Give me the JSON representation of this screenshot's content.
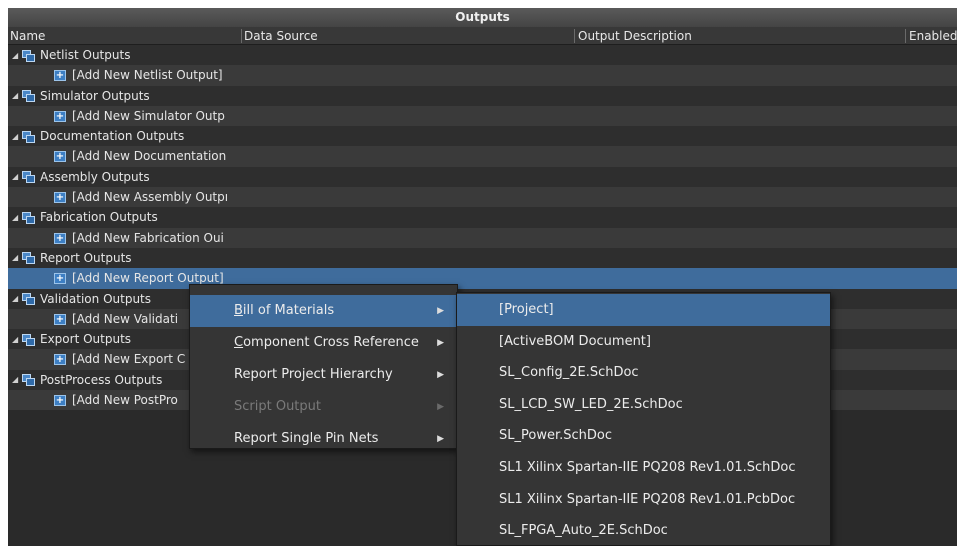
{
  "panel": {
    "title": "Outputs",
    "columns": [
      "Name",
      "Data Source",
      "Output Description",
      "Enabled"
    ]
  },
  "rows": [
    {
      "type": "group",
      "label": "Netlist Outputs"
    },
    {
      "type": "child",
      "label": "[Add New Netlist Output]"
    },
    {
      "type": "group",
      "label": "Simulator Outputs"
    },
    {
      "type": "child",
      "label": "[Add New Simulator Outp"
    },
    {
      "type": "group",
      "label": "Documentation Outputs"
    },
    {
      "type": "child",
      "label": "[Add New Documentation"
    },
    {
      "type": "group",
      "label": "Assembly Outputs"
    },
    {
      "type": "child",
      "label": "[Add New Assembly Outpı"
    },
    {
      "type": "group",
      "label": "Fabrication Outputs"
    },
    {
      "type": "child",
      "label": "[Add New Fabrication Oui"
    },
    {
      "type": "group",
      "label": "Report Outputs"
    },
    {
      "type": "child",
      "label": "[Add New Report Output]",
      "selected": true
    },
    {
      "type": "group",
      "label": "Validation Outputs"
    },
    {
      "type": "child",
      "label": "[Add New Validati"
    },
    {
      "type": "group",
      "label": "Export Outputs"
    },
    {
      "type": "child",
      "label": "[Add New Export C"
    },
    {
      "type": "group",
      "label": "PostProcess Outputs"
    },
    {
      "type": "child",
      "label": "[Add New PostPro"
    }
  ],
  "context_menu": {
    "items": [
      {
        "label_underlined": "B",
        "label_rest": "ill of Materials",
        "state": "active",
        "submenu": true
      },
      {
        "label_underlined": "C",
        "label_rest": "omponent Cross Reference",
        "state": "normal",
        "submenu": true
      },
      {
        "label_underlined": "",
        "label_rest": "Report Project Hierarchy",
        "state": "normal",
        "submenu": true
      },
      {
        "label_underlined": "",
        "label_rest": "Script Output",
        "state": "disabled",
        "submenu": true
      },
      {
        "label_underlined": "",
        "label_rest": "Report Single Pin Nets",
        "state": "normal",
        "submenu": true
      }
    ]
  },
  "submenu": {
    "items": [
      {
        "label": "[Project]",
        "state": "active"
      },
      {
        "label": "[ActiveBOM Document]",
        "state": "normal"
      },
      {
        "label": "SL_Config_2E.SchDoc",
        "state": "normal"
      },
      {
        "label": "SL_LCD_SW_LED_2E.SchDoc",
        "state": "normal"
      },
      {
        "label": "SL_Power.SchDoc",
        "state": "normal"
      },
      {
        "label": "SL1 Xilinx Spartan-IIE PQ208 Rev1.01.SchDoc",
        "state": "normal"
      },
      {
        "label": "SL1 Xilinx Spartan-IIE PQ208 Rev1.01.PcbDoc",
        "state": "normal"
      },
      {
        "label": "SL_FPGA_Auto_2E.SchDoc",
        "state": "normal"
      }
    ]
  },
  "icons": {
    "expand": "triangle-expanded-icon",
    "group": "output-group-icon",
    "add": "add-output-icon",
    "submenu": "submenu-arrow-icon"
  },
  "colors": {
    "background": "#2a2a2a",
    "selection": "#3f6c9c",
    "text": "#e6e6e6",
    "disabled_text": "#7a7a7a"
  }
}
